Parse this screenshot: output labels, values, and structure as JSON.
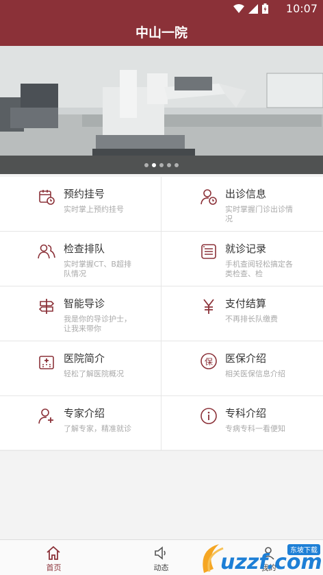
{
  "status_bar": {
    "time": "10:07"
  },
  "app": {
    "title": "中山一院"
  },
  "banner": {
    "slide_count": 5,
    "active_slide": 2
  },
  "menu": [
    {
      "title": "预约挂号",
      "desc": "实时掌上预约挂号",
      "icon": "calendar-clock-icon"
    },
    {
      "title": "出诊信息",
      "desc": "实时掌握门诊出诊情况",
      "icon": "doctor-schedule-icon"
    },
    {
      "title": "检查排队",
      "desc": "实时掌握CT、B超排队情况",
      "icon": "people-queue-icon"
    },
    {
      "title": "就诊记录",
      "desc": "手机查阅轻松搞定各类检查、检",
      "icon": "record-list-icon"
    },
    {
      "title": "智能导诊",
      "desc": "我是你的导诊护士，让我来带你",
      "icon": "signpost-icon"
    },
    {
      "title": "支付结算",
      "desc": "不再排长队缴费",
      "icon": "yuan-icon"
    },
    {
      "title": "医院简介",
      "desc": "轻松了解医院概况",
      "icon": "hospital-icon"
    },
    {
      "title": "医保介绍",
      "desc": "相关医保信息介绍",
      "icon": "insurance-icon"
    },
    {
      "title": "专家介绍",
      "desc": "了解专家，精准就诊",
      "icon": "add-user-icon"
    },
    {
      "title": "专科介绍",
      "desc": "专病专科一看便知",
      "icon": "info-icon"
    }
  ],
  "tabs": [
    {
      "label": "首页",
      "icon": "home-icon",
      "active": true
    },
    {
      "label": "动态",
      "icon": "speaker-icon",
      "active": false
    },
    {
      "label": "我的",
      "icon": "user-icon",
      "active": false
    }
  ],
  "watermark": {
    "text": "uzzf.com",
    "badge": "东坡下载"
  },
  "colors": {
    "primary": "#8b3138",
    "icon": "#8b3138",
    "desc_text": "#aaaaaa"
  }
}
